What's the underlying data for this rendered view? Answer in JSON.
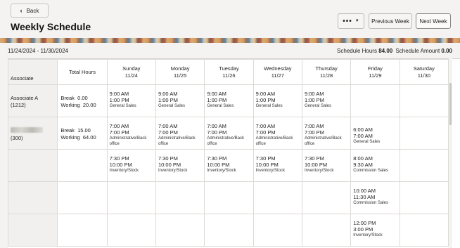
{
  "header": {
    "back_label": "Back",
    "title": "Weekly Schedule",
    "more_label": "•••",
    "prev_week_label": "Previous Week",
    "next_week_label": "Next Week"
  },
  "range": {
    "dates": "11/24/2024 - 11/30/2024",
    "hours_label": "Schedule Hours",
    "hours_value": "84.00",
    "amount_label": "Schedule Amount",
    "amount_value": "0.00"
  },
  "table": {
    "assoc_header": "Associate",
    "total_header": "Total Hours",
    "days": [
      {
        "name": "Sunday",
        "date": "11/24"
      },
      {
        "name": "Monday",
        "date": "11/25"
      },
      {
        "name": "Tuesday",
        "date": "11/26"
      },
      {
        "name": "Wednesday",
        "date": "11/27"
      },
      {
        "name": "Thursday",
        "date": "11/28"
      },
      {
        "name": "Friday",
        "date": "11/29"
      },
      {
        "name": "Saturday",
        "date": "11/30"
      }
    ],
    "rows": [
      {
        "assoc_name": "Associate A",
        "assoc_id": "(1212)",
        "break": "Break  0.00",
        "working": "Working  20.00",
        "cells": [
          {
            "start": "9:00 AM",
            "end": "1:00 PM",
            "dept": "General Sales"
          },
          {
            "start": "9:00 AM",
            "end": "1:00 PM",
            "dept": "General Sales"
          },
          {
            "start": "9:00 AM",
            "end": "1:00 PM",
            "dept": "General Sales"
          },
          {
            "start": "9:00 AM",
            "end": "1:00 PM",
            "dept": "General Sales"
          },
          {
            "start": "9:00 AM",
            "end": "1:00 PM",
            "dept": "General Sales"
          },
          null,
          null
        ]
      },
      {
        "assoc_name": "",
        "assoc_id": "(300)",
        "break": "Break  15.00",
        "working": "Working  64.00",
        "cells": [
          {
            "start": "7:00 AM",
            "end": "7:00 PM",
            "dept": "Administrative/Back office"
          },
          {
            "start": "7:00 AM",
            "end": "7:00 PM",
            "dept": "Administrative/Back office"
          },
          {
            "start": "7:00 AM",
            "end": "7:00 PM",
            "dept": "Administrative/Back office"
          },
          {
            "start": "7:00 AM",
            "end": "7:00 PM",
            "dept": "Administrative/Back office"
          },
          {
            "start": "7:00 AM",
            "end": "7:00 PM",
            "dept": "Administrative/Back office"
          },
          {
            "start": "6:00 AM",
            "end": "7:00 AM",
            "dept": "General Sales"
          },
          null
        ]
      },
      {
        "cells": [
          {
            "start": "7:30 PM",
            "end": "10:00 PM",
            "dept": "Inventory/Stock"
          },
          {
            "start": "7:30 PM",
            "end": "10:00 PM",
            "dept": "Inventory/Stock"
          },
          {
            "start": "7:30 PM",
            "end": "10:00 PM",
            "dept": "Inventory/Stock"
          },
          {
            "start": "7:30 PM",
            "end": "10:00 PM",
            "dept": "Inventory/Stock"
          },
          {
            "start": "7:30 PM",
            "end": "10:00 PM",
            "dept": "Inventory/Stock"
          },
          {
            "start": "8:00 AM",
            "end": "9:30 AM",
            "dept": "Commission Sales"
          },
          null
        ]
      },
      {
        "cells": [
          null,
          null,
          null,
          null,
          null,
          {
            "start": "10:00 AM",
            "end": "11:30 AM",
            "dept": "Commission Sales"
          },
          null
        ]
      },
      {
        "cells": [
          null,
          null,
          null,
          null,
          null,
          {
            "start": "12:00 PM",
            "end": "3:00 PM",
            "dept": "Inventory/Stock"
          },
          null
        ]
      }
    ]
  }
}
